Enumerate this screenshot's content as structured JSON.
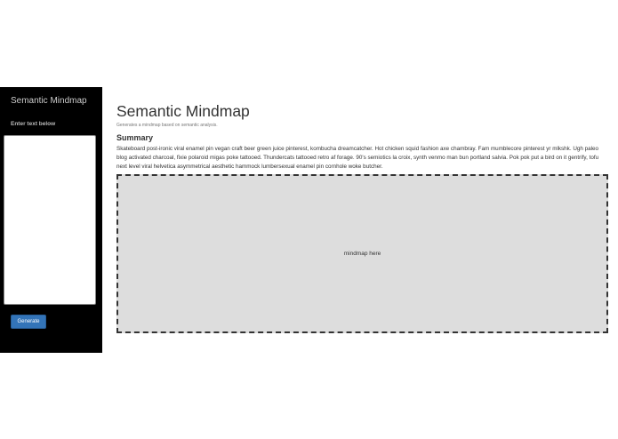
{
  "sidebar": {
    "brand": "Semantic Mindmap",
    "input_label": "Enter text below",
    "textarea_value": "",
    "generate_label": "Generate"
  },
  "main": {
    "title": "Semantic Mindmap",
    "subtitle": "Generates a mindmap based on semantic analysis.",
    "summary_heading": "Summary",
    "summary_text": "Skateboard post-ironic viral enamel pin vegan craft beer green juice pinterest, kombucha dreamcatcher. Hot chicken squid fashion axe chambray. Fam mumblecore pinterest yr mlkshk. Ugh paleo blog activated charcoal, fixie polaroid migas poke tattooed. Thundercats tattooed retro af forage. 90's semiotics la croix, synth venmo man bun portland salvia. Pok pok put a bird on it gentrify, tofu next level viral helvetica asymmetrical aesthetic hammock lumbersexual enamel pin cornhole woke butcher.",
    "mindmap_placeholder": "mindmap here"
  },
  "colors": {
    "sidebar_bg": "#000000",
    "button_bg": "#3374b8",
    "mindmap_bg": "#dddddd"
  }
}
